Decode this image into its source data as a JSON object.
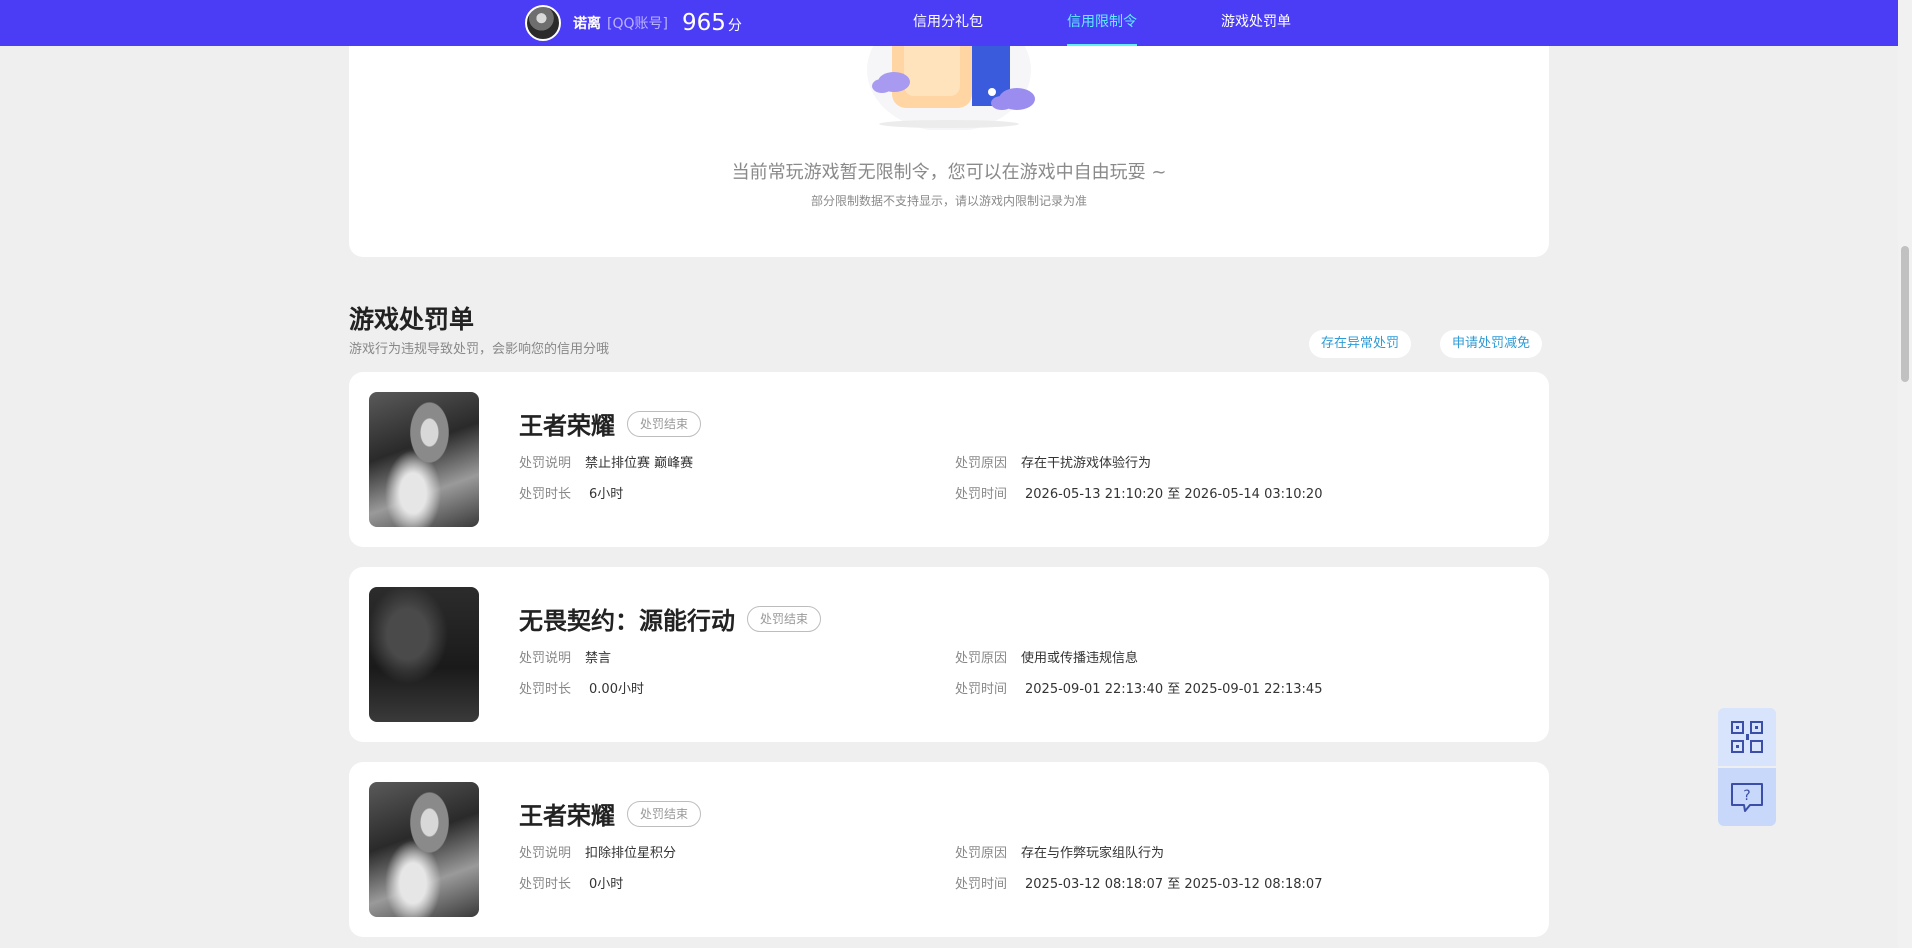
{
  "header": {
    "user_name": "诺离",
    "account_type": "[QQ账号]",
    "score": "965",
    "score_unit": "分",
    "tabs": [
      {
        "label": "信用分礼包",
        "active": false
      },
      {
        "label": "信用限制令",
        "active": true
      },
      {
        "label": "游戏处罚单",
        "active": false
      }
    ],
    "accent_color": "#4b3cf5",
    "active_tab_color": "#5ff0ff"
  },
  "restriction": {
    "empty_title": "当前常玩游戏暂无限制令，您可以在游戏中自由玩耍 ~",
    "empty_note": "部分限制数据不支持显示，请以游戏内限制记录为准"
  },
  "penalties": {
    "title": "游戏处罚单",
    "subtitle": "游戏行为违规导致处罚，会影响您的信用分哦",
    "actions": {
      "report_abnormal": "存在异常处罚",
      "apply_reduction": "申请处罚减免"
    },
    "labels": {
      "desc": "处罚说明",
      "duration": "处罚时长",
      "reason": "处罚原因",
      "time": "处罚时间",
      "to": "至"
    },
    "items": [
      {
        "game": "王者荣耀",
        "status": "处罚结束",
        "desc": "禁止排位赛 巅峰赛",
        "duration": "6小时",
        "reason": "存在干扰游戏体验行为",
        "start": "2026-05-13 21:10:20",
        "end": "2026-05-14 03:10:20",
        "cover_icon": "honor-of-kings-cover"
      },
      {
        "game": "无畏契约：源能行动",
        "status": "处罚结束",
        "desc": "禁言",
        "duration": "0.00小时",
        "reason": "使用或传播违规信息",
        "start": "2025-09-01 22:13:40",
        "end": "2025-09-01 22:13:45",
        "cover_icon": "valorant-cover"
      },
      {
        "game": "王者荣耀",
        "status": "处罚结束",
        "desc": "扣除排位星积分",
        "duration": "0小时",
        "reason": "存在与作弊玩家组队行为",
        "start": "2025-03-12 08:18:07",
        "end": "2025-03-12 08:18:07",
        "cover_icon": "honor-of-kings-cover"
      }
    ]
  },
  "tools": {
    "qr_icon": "qr-code-icon",
    "help_icon": "help-message-icon"
  }
}
